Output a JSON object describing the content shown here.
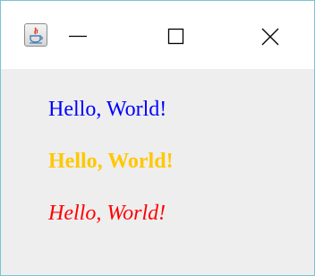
{
  "window": {
    "icon": "java-app-icon",
    "controls": {
      "minimize_icon": "minimize-icon",
      "maximize_icon": "maximize-icon",
      "close_icon": "close-icon"
    }
  },
  "content": {
    "lines": [
      {
        "text": "Hello, World!",
        "color": "#0000ff",
        "style": "plain"
      },
      {
        "text": "Hello, World!",
        "color": "#ffc800",
        "style": "bold"
      },
      {
        "text": "Hello, World!",
        "color": "#ff0000",
        "style": "italic"
      }
    ]
  },
  "colors": {
    "titlebar_bg": "#ffffff",
    "content_bg": "#eeeeee",
    "window_border": "#7ac4d3"
  }
}
